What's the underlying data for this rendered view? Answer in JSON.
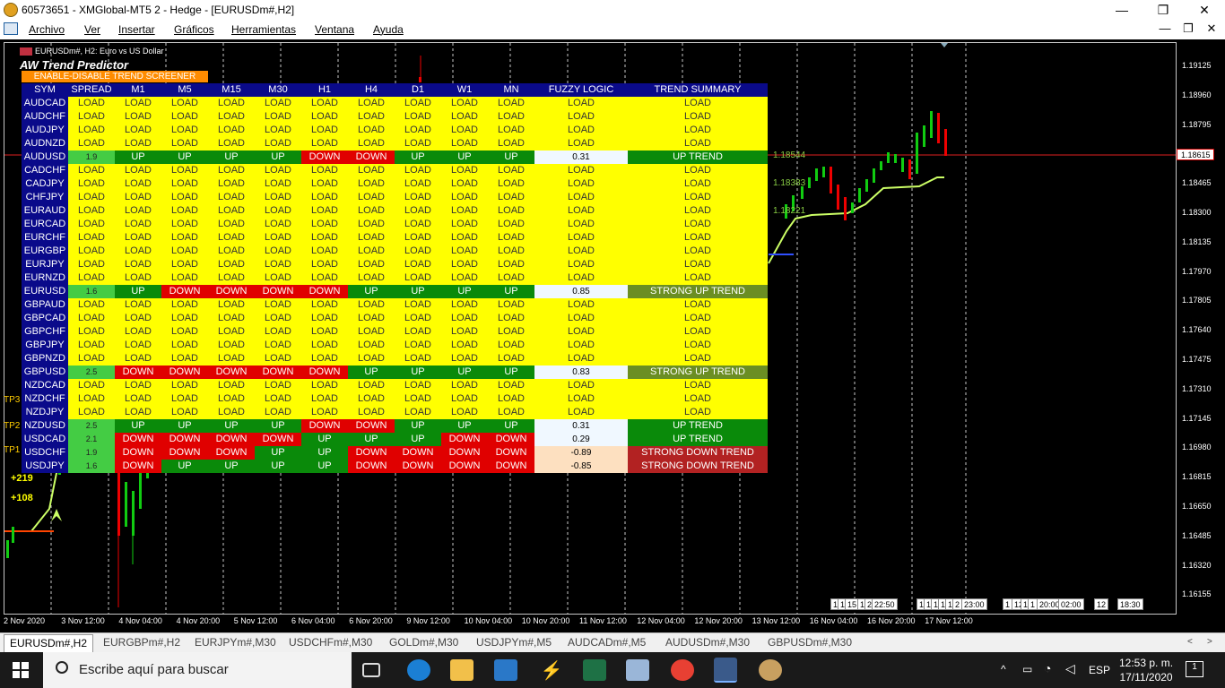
{
  "window": {
    "title": "60573651 - XMGlobal-MT5 2 - Hedge - [EURUSDm#,H2]",
    "minimize": "—",
    "maximize": "❐",
    "close": "✕"
  },
  "menu": [
    "Archivo",
    "Ver",
    "Insertar",
    "Gráficos",
    "Herramientas",
    "Ventana",
    "Ayuda"
  ],
  "chart": {
    "header": "EURUSDm#, H2:  Euro vs US Dollar",
    "indicator": "AW Trend Predictor",
    "enable_button": "ENABLE-DISABLE TREND SCREENER",
    "current_price": "1.18615",
    "price_axis": [
      "1.19125",
      "1.18960",
      "1.18795",
      "1.18615",
      "1.18465",
      "1.18300",
      "1.18135",
      "1.17970",
      "1.17805",
      "1.17640",
      "1.17475",
      "1.17310",
      "1.17145",
      "1.16980",
      "1.16815",
      "1.16650",
      "1.16485",
      "1.16320",
      "1.16155"
    ],
    "date_axis": [
      "2 Nov 2020",
      "3 Nov 12:00",
      "4 Nov 04:00",
      "4 Nov 20:00",
      "5 Nov 12:00",
      "6 Nov 04:00",
      "6 Nov 20:00",
      "9 Nov 12:00",
      "10 Nov 04:00",
      "10 Nov 20:00",
      "11 Nov 12:00",
      "12 Nov 04:00",
      "12 Nov 20:00",
      "13 Nov 12:00",
      "16 Nov 04:00",
      "16 Nov 20:00",
      "17 Nov 12:00"
    ],
    "tp_labels": [
      "TP3",
      "TP2",
      "TP1"
    ],
    "points": [
      "+219",
      "+108"
    ],
    "level_labels": [
      "1.18544",
      "1.18383",
      "1.18221"
    ],
    "period_buttons": [
      "1",
      "1",
      "15",
      "1",
      "2",
      "22:50",
      "1",
      "1",
      "1",
      "1",
      "1",
      "2",
      "23:00",
      "1",
      "12",
      "1",
      "1",
      "20:00",
      "02:00",
      "12",
      "18:30"
    ]
  },
  "screener": {
    "headers": [
      "SYM",
      "SPREAD",
      "M1",
      "M5",
      "M15",
      "M30",
      "H1",
      "H4",
      "D1",
      "W1",
      "MN",
      "FUZZY LOGIC",
      "TREND SUMMARY"
    ],
    "rows": [
      {
        "sym": "AUDCAD",
        "spread": "LOAD",
        "tf": [
          "LOAD",
          "LOAD",
          "LOAD",
          "LOAD",
          "LOAD",
          "LOAD",
          "LOAD",
          "LOAD",
          "LOAD"
        ],
        "fuzzy": "LOAD",
        "summary": "LOAD"
      },
      {
        "sym": "AUDCHF",
        "spread": "LOAD",
        "tf": [
          "LOAD",
          "LOAD",
          "LOAD",
          "LOAD",
          "LOAD",
          "LOAD",
          "LOAD",
          "LOAD",
          "LOAD"
        ],
        "fuzzy": "LOAD",
        "summary": "LOAD"
      },
      {
        "sym": "AUDJPY",
        "spread": "LOAD",
        "tf": [
          "LOAD",
          "LOAD",
          "LOAD",
          "LOAD",
          "LOAD",
          "LOAD",
          "LOAD",
          "LOAD",
          "LOAD"
        ],
        "fuzzy": "LOAD",
        "summary": "LOAD"
      },
      {
        "sym": "AUDNZD",
        "spread": "LOAD",
        "tf": [
          "LOAD",
          "LOAD",
          "LOAD",
          "LOAD",
          "LOAD",
          "LOAD",
          "LOAD",
          "LOAD",
          "LOAD"
        ],
        "fuzzy": "LOAD",
        "summary": "LOAD"
      },
      {
        "sym": "AUDUSD",
        "spread": "1.9",
        "tf": [
          "UP",
          "UP",
          "UP",
          "UP",
          "DOWN",
          "DOWN",
          "UP",
          "UP",
          "UP"
        ],
        "fuzzy": "0.31",
        "summary": "UP TREND"
      },
      {
        "sym": "CADCHF",
        "spread": "LOAD",
        "tf": [
          "LOAD",
          "LOAD",
          "LOAD",
          "LOAD",
          "LOAD",
          "LOAD",
          "LOAD",
          "LOAD",
          "LOAD"
        ],
        "fuzzy": "LOAD",
        "summary": "LOAD"
      },
      {
        "sym": "CADJPY",
        "spread": "LOAD",
        "tf": [
          "LOAD",
          "LOAD",
          "LOAD",
          "LOAD",
          "LOAD",
          "LOAD",
          "LOAD",
          "LOAD",
          "LOAD"
        ],
        "fuzzy": "LOAD",
        "summary": "LOAD"
      },
      {
        "sym": "CHFJPY",
        "spread": "LOAD",
        "tf": [
          "LOAD",
          "LOAD",
          "LOAD",
          "LOAD",
          "LOAD",
          "LOAD",
          "LOAD",
          "LOAD",
          "LOAD"
        ],
        "fuzzy": "LOAD",
        "summary": "LOAD"
      },
      {
        "sym": "EURAUD",
        "spread": "LOAD",
        "tf": [
          "LOAD",
          "LOAD",
          "LOAD",
          "LOAD",
          "LOAD",
          "LOAD",
          "LOAD",
          "LOAD",
          "LOAD"
        ],
        "fuzzy": "LOAD",
        "summary": "LOAD"
      },
      {
        "sym": "EURCAD",
        "spread": "LOAD",
        "tf": [
          "LOAD",
          "LOAD",
          "LOAD",
          "LOAD",
          "LOAD",
          "LOAD",
          "LOAD",
          "LOAD",
          "LOAD"
        ],
        "fuzzy": "LOAD",
        "summary": "LOAD"
      },
      {
        "sym": "EURCHF",
        "spread": "LOAD",
        "tf": [
          "LOAD",
          "LOAD",
          "LOAD",
          "LOAD",
          "LOAD",
          "LOAD",
          "LOAD",
          "LOAD",
          "LOAD"
        ],
        "fuzzy": "LOAD",
        "summary": "LOAD"
      },
      {
        "sym": "EURGBP",
        "spread": "LOAD",
        "tf": [
          "LOAD",
          "LOAD",
          "LOAD",
          "LOAD",
          "LOAD",
          "LOAD",
          "LOAD",
          "LOAD",
          "LOAD"
        ],
        "fuzzy": "LOAD",
        "summary": "LOAD"
      },
      {
        "sym": "EURJPY",
        "spread": "LOAD",
        "tf": [
          "LOAD",
          "LOAD",
          "LOAD",
          "LOAD",
          "LOAD",
          "LOAD",
          "LOAD",
          "LOAD",
          "LOAD"
        ],
        "fuzzy": "LOAD",
        "summary": "LOAD"
      },
      {
        "sym": "EURNZD",
        "spread": "LOAD",
        "tf": [
          "LOAD",
          "LOAD",
          "LOAD",
          "LOAD",
          "LOAD",
          "LOAD",
          "LOAD",
          "LOAD",
          "LOAD"
        ],
        "fuzzy": "LOAD",
        "summary": "LOAD"
      },
      {
        "sym": "EURUSD",
        "spread": "1.6",
        "tf": [
          "UP",
          "DOWN",
          "DOWN",
          "DOWN",
          "DOWN",
          "UP",
          "UP",
          "UP",
          "UP"
        ],
        "fuzzy": "0.85",
        "summary": "STRONG UP TREND"
      },
      {
        "sym": "GBPAUD",
        "spread": "LOAD",
        "tf": [
          "LOAD",
          "LOAD",
          "LOAD",
          "LOAD",
          "LOAD",
          "LOAD",
          "LOAD",
          "LOAD",
          "LOAD"
        ],
        "fuzzy": "LOAD",
        "summary": "LOAD"
      },
      {
        "sym": "GBPCAD",
        "spread": "LOAD",
        "tf": [
          "LOAD",
          "LOAD",
          "LOAD",
          "LOAD",
          "LOAD",
          "LOAD",
          "LOAD",
          "LOAD",
          "LOAD"
        ],
        "fuzzy": "LOAD",
        "summary": "LOAD"
      },
      {
        "sym": "GBPCHF",
        "spread": "LOAD",
        "tf": [
          "LOAD",
          "LOAD",
          "LOAD",
          "LOAD",
          "LOAD",
          "LOAD",
          "LOAD",
          "LOAD",
          "LOAD"
        ],
        "fuzzy": "LOAD",
        "summary": "LOAD"
      },
      {
        "sym": "GBPJPY",
        "spread": "LOAD",
        "tf": [
          "LOAD",
          "LOAD",
          "LOAD",
          "LOAD",
          "LOAD",
          "LOAD",
          "LOAD",
          "LOAD",
          "LOAD"
        ],
        "fuzzy": "LOAD",
        "summary": "LOAD"
      },
      {
        "sym": "GBPNZD",
        "spread": "LOAD",
        "tf": [
          "LOAD",
          "LOAD",
          "LOAD",
          "LOAD",
          "LOAD",
          "LOAD",
          "LOAD",
          "LOAD",
          "LOAD"
        ],
        "fuzzy": "LOAD",
        "summary": "LOAD"
      },
      {
        "sym": "GBPUSD",
        "spread": "2.5",
        "tf": [
          "DOWN",
          "DOWN",
          "DOWN",
          "DOWN",
          "DOWN",
          "UP",
          "UP",
          "UP",
          "UP"
        ],
        "fuzzy": "0.83",
        "summary": "STRONG UP TREND"
      },
      {
        "sym": "NZDCAD",
        "spread": "LOAD",
        "tf": [
          "LOAD",
          "LOAD",
          "LOAD",
          "LOAD",
          "LOAD",
          "LOAD",
          "LOAD",
          "LOAD",
          "LOAD"
        ],
        "fuzzy": "LOAD",
        "summary": "LOAD"
      },
      {
        "sym": "NZDCHF",
        "spread": "LOAD",
        "tf": [
          "LOAD",
          "LOAD",
          "LOAD",
          "LOAD",
          "LOAD",
          "LOAD",
          "LOAD",
          "LOAD",
          "LOAD"
        ],
        "fuzzy": "LOAD",
        "summary": "LOAD"
      },
      {
        "sym": "NZDJPY",
        "spread": "LOAD",
        "tf": [
          "LOAD",
          "LOAD",
          "LOAD",
          "LOAD",
          "LOAD",
          "LOAD",
          "LOAD",
          "LOAD",
          "LOAD"
        ],
        "fuzzy": "LOAD",
        "summary": "LOAD"
      },
      {
        "sym": "NZDUSD",
        "spread": "2.5",
        "tf": [
          "UP",
          "UP",
          "UP",
          "UP",
          "DOWN",
          "DOWN",
          "UP",
          "UP",
          "UP"
        ],
        "fuzzy": "0.31",
        "summary": "UP TREND"
      },
      {
        "sym": "USDCAD",
        "spread": "2.1",
        "tf": [
          "DOWN",
          "DOWN",
          "DOWN",
          "DOWN",
          "UP",
          "UP",
          "UP",
          "DOWN",
          "DOWN"
        ],
        "fuzzy": "0.29",
        "summary": "UP TREND"
      },
      {
        "sym": "USDCHF",
        "spread": "1.9",
        "tf": [
          "DOWN",
          "DOWN",
          "DOWN",
          "UP",
          "UP",
          "DOWN",
          "DOWN",
          "DOWN",
          "DOWN"
        ],
        "fuzzy": "-0.89",
        "summary": "STRONG DOWN TREND"
      },
      {
        "sym": "USDJPY",
        "spread": "1.6",
        "tf": [
          "DOWN",
          "UP",
          "UP",
          "UP",
          "UP",
          "DOWN",
          "DOWN",
          "DOWN",
          "DOWN"
        ],
        "fuzzy": "-0.85",
        "summary": "STRONG DOWN TREND"
      }
    ]
  },
  "tabs": [
    "EURUSDm#,H2",
    "EURGBPm#,H2",
    "EURJPYm#,M30",
    "USDCHFm#,M30",
    "GOLDm#,M30",
    "USDJPYm#,M5",
    "AUDCADm#,M5",
    "AUDUSDm#,M30",
    "GBPUSDm#,M30"
  ],
  "taskbar": {
    "search_placeholder": "Escribe aquí para buscar",
    "lang": "ESP",
    "time": "12:53 p. m.",
    "date": "17/11/2020",
    "notif_count": "1"
  }
}
